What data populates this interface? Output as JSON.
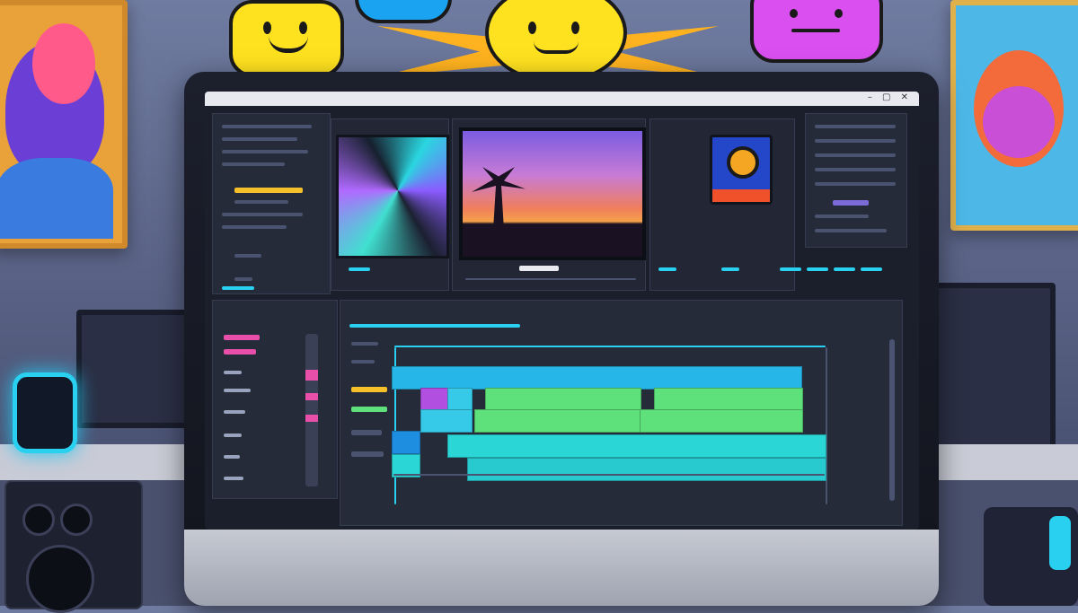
{
  "scene": {
    "description_colors": {
      "accent_cyan": "#2ad0f0",
      "accent_green": "#5ee07a",
      "accent_magenta": "#d94ff0",
      "accent_yellow": "#ffe21f",
      "screen_bg": "#1b1f2b"
    }
  },
  "titlebar": {
    "window_controls": "– ▢ ✕"
  },
  "icons": {
    "app_icon": "camera-lens-icon",
    "emoji_left": "smiley-bubble-icon",
    "emoji_center": "grinning-face-icon",
    "emoji_right": "flat-face-bubble-icon"
  }
}
